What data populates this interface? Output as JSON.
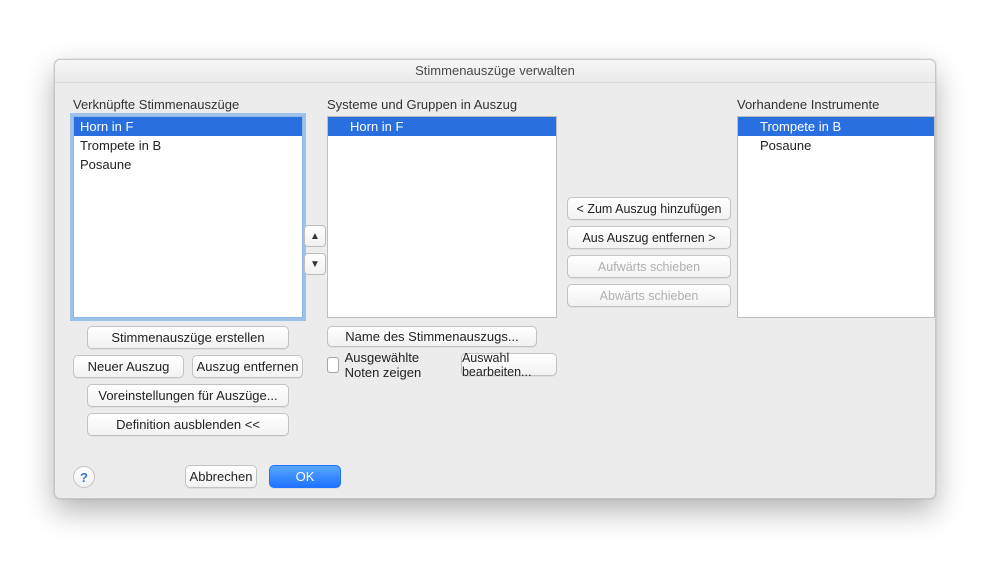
{
  "window": {
    "title": "Stimmenauszüge verwalten"
  },
  "left": {
    "label": "Verknüpfte Stimmenauszüge",
    "items": [
      "Horn in F",
      "Trompete in B",
      "Posaune"
    ]
  },
  "center": {
    "label": "Systeme und Gruppen in Auszug",
    "items": [
      "Horn in F"
    ]
  },
  "right": {
    "label": "Vorhandene Instrumente",
    "items": [
      "Trompete in B",
      "Posaune"
    ]
  },
  "move": {
    "add": "< Zum Auszug hinzufügen",
    "remove": "Aus Auszug entfernen >",
    "up": "Aufwärts schieben",
    "down": "Abwärts schieben"
  },
  "left_buttons": {
    "generate": "Stimmenauszüge erstellen",
    "new": "Neuer Auszug",
    "delete": "Auszug entfernen",
    "prefs": "Voreinstellungen für Auszüge...",
    "hidedef": "Definition ausblenden <<"
  },
  "center_buttons": {
    "rename": "Name des Stimmenauszugs...",
    "show_selected": "Ausgewählte Noten zeigen",
    "edit_selection": "Auswahl bearbeiten..."
  },
  "footer": {
    "cancel": "Abbrechen",
    "ok": "OK",
    "help": "?"
  }
}
